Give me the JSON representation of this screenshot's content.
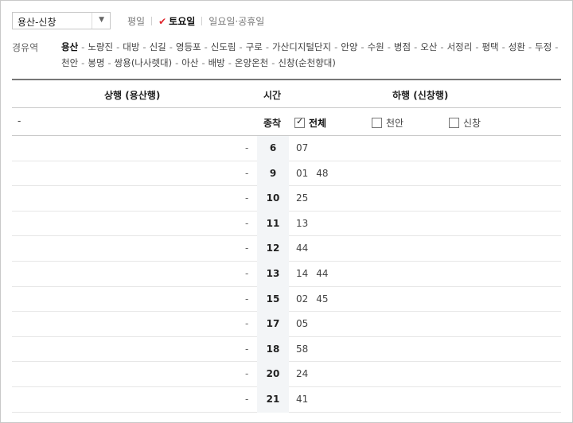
{
  "route": {
    "selected": "용산-신창"
  },
  "day_tabs": [
    {
      "label": "평일",
      "active": false
    },
    {
      "label": "토요일",
      "active": true
    },
    {
      "label": "일요일·공휴일",
      "active": false
    }
  ],
  "via": {
    "label": "경유역",
    "stations": [
      "용산",
      "노량진",
      "대방",
      "신길",
      "영등포",
      "신도림",
      "구로",
      "가산디지털단지",
      "안양",
      "수원",
      "병점",
      "오산",
      "서정리",
      "평택",
      "성환",
      "두정",
      "천안",
      "봉명",
      "쌍용(나사렛대)",
      "아산",
      "배방",
      "온양온천",
      "신창(순천향대)"
    ]
  },
  "table": {
    "header": {
      "up": "상행 (용산행)",
      "time": "시간",
      "down": "하행 (신창행)"
    },
    "filter_row": {
      "up_value": "-",
      "terminal_label": "종착",
      "checkboxes": [
        {
          "label": "전체",
          "checked": true
        },
        {
          "label": "천안",
          "checked": false
        },
        {
          "label": "신창",
          "checked": false
        }
      ]
    },
    "rows": [
      {
        "up": "-",
        "hour": "6",
        "mins": [
          "07"
        ]
      },
      {
        "up": "-",
        "hour": "9",
        "mins": [
          "01",
          "48"
        ]
      },
      {
        "up": "-",
        "hour": "10",
        "mins": [
          "25"
        ]
      },
      {
        "up": "-",
        "hour": "11",
        "mins": [
          "13"
        ]
      },
      {
        "up": "-",
        "hour": "12",
        "mins": [
          "44"
        ]
      },
      {
        "up": "-",
        "hour": "13",
        "mins": [
          "14",
          "44"
        ]
      },
      {
        "up": "-",
        "hour": "15",
        "mins": [
          "02",
          "45"
        ]
      },
      {
        "up": "-",
        "hour": "17",
        "mins": [
          "05"
        ]
      },
      {
        "up": "-",
        "hour": "18",
        "mins": [
          "58"
        ]
      },
      {
        "up": "-",
        "hour": "20",
        "mins": [
          "24"
        ]
      },
      {
        "up": "-",
        "hour": "21",
        "mins": [
          "41"
        ]
      }
    ]
  },
  "colors": {
    "check_mark": "#e0242b",
    "hour_bg": "#f3f5f7",
    "header_border": "#777777"
  },
  "icons": {
    "dropdown": "chevron-down-icon",
    "active_tab": "check-icon"
  }
}
